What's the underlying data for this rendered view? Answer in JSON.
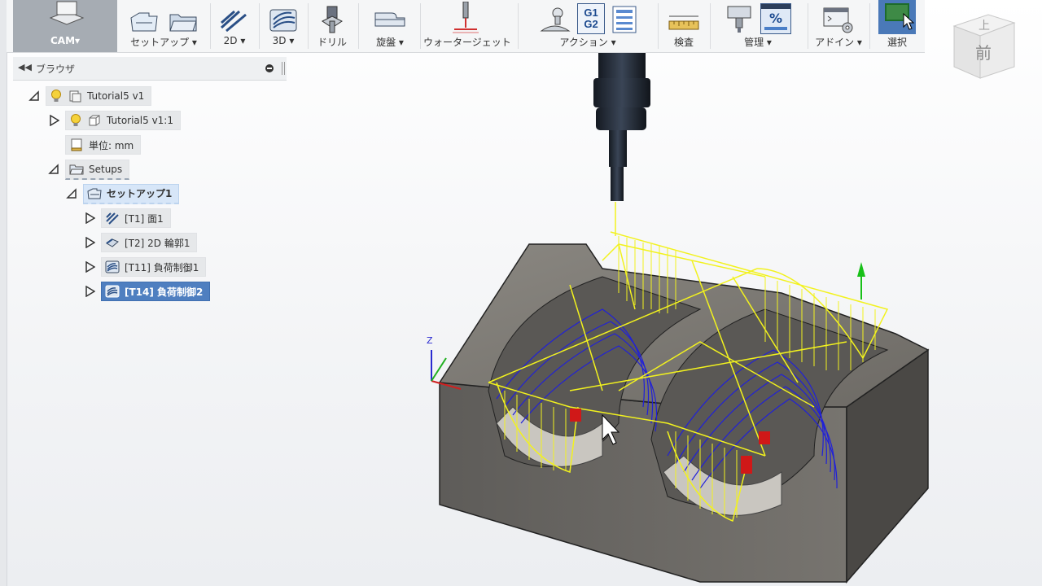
{
  "toolbar": {
    "workspace": "CAM▾",
    "groups": [
      {
        "label": "セットアップ ▾"
      },
      {
        "label": "2D ▾"
      },
      {
        "label": "3D ▾"
      },
      {
        "label": "ドリル"
      },
      {
        "label": "旋盤 ▾"
      },
      {
        "label": "ウォータージェット"
      },
      {
        "label": "アクション ▾"
      },
      {
        "label": "検査"
      },
      {
        "label": "管理 ▾"
      },
      {
        "label": "アドイン ▾"
      },
      {
        "label": "選択"
      }
    ],
    "action_g_label_top": "G1",
    "action_g_label_bottom": "G2",
    "manage_percent": "%"
  },
  "viewcube": {
    "top": "上",
    "front": "前"
  },
  "browser": {
    "title": "ブラウザ",
    "nodes": [
      {
        "label": "Tutorial5 v1"
      },
      {
        "label": "Tutorial5 v1:1"
      },
      {
        "label": "単位: mm"
      },
      {
        "label": "Setups"
      },
      {
        "label": "セットアップ1"
      },
      {
        "label": "[T1] 面1"
      },
      {
        "label": "[T2] 2D 輪郭1"
      },
      {
        "label": "[T11] 負荷制御1"
      },
      {
        "label": "[T14] 負荷制御2"
      }
    ]
  },
  "triad": {
    "z": "Z"
  },
  "colors": {
    "toolpath_yellow": "#f2f21e",
    "toolpath_blue": "#2020d8",
    "stock_gray": "#6c6a66",
    "select_blue": "#4f7fc0"
  }
}
